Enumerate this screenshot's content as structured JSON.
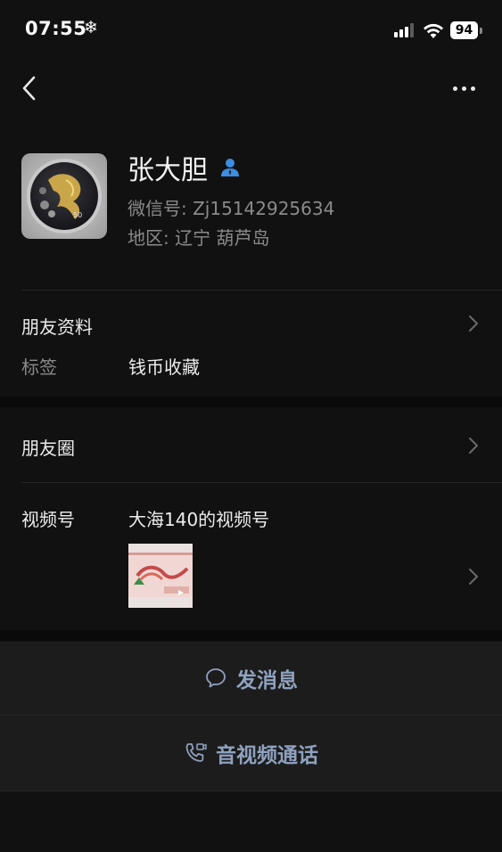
{
  "status_bar": {
    "time": "07:55",
    "snowflake": "❄",
    "battery": "94"
  },
  "nav": {
    "back_icon": "chevron-left-icon",
    "more_icon": "more-dots-icon"
  },
  "profile": {
    "name": "张大胆",
    "badge_icon": "star-friend-icon",
    "wechat_id": "微信号: Zj15142925634",
    "region": "地区: 辽宁  葫芦岛"
  },
  "friend_info": {
    "title": "朋友资料",
    "tag_label": "标签",
    "tag_value": "钱币收藏"
  },
  "moments": {
    "title": "朋友圈"
  },
  "channels": {
    "title": "视频号",
    "name": "大海140的视频号"
  },
  "actions": {
    "message": "发消息",
    "call": "音视频通话"
  },
  "colors": {
    "background": "#111111",
    "panel": "#1c1c1c",
    "accent": "#8fa1bf",
    "secondary_text": "#8a8a8a"
  }
}
